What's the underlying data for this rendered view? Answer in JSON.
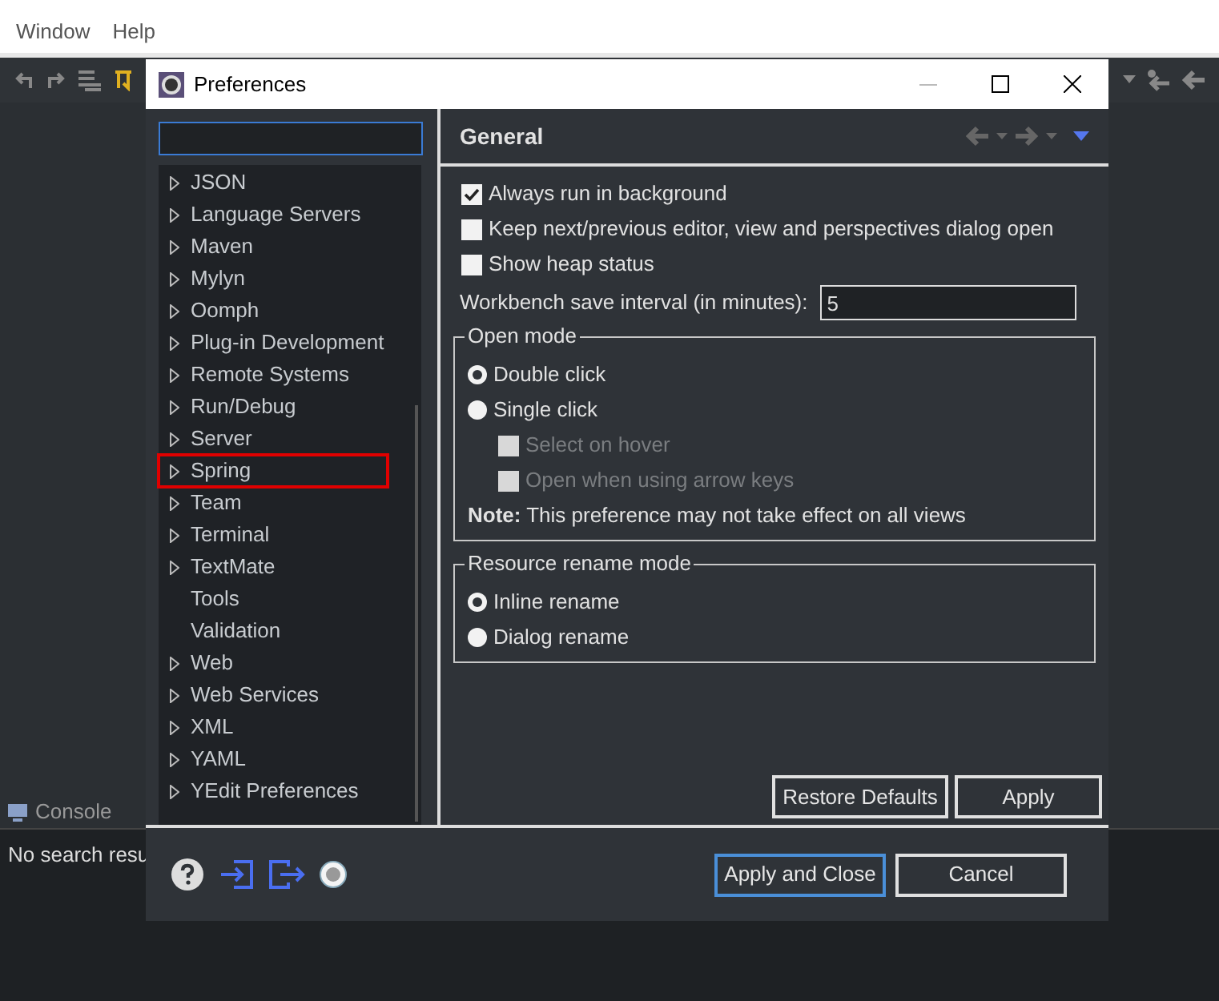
{
  "menu": [
    "Window",
    "Help"
  ],
  "console_tab": {
    "label": "Console"
  },
  "console_text": "No search resu",
  "dialog": {
    "title": "Preferences",
    "tree": [
      {
        "label": "JSON",
        "expandable": true,
        "marked": false
      },
      {
        "label": "Language Servers",
        "expandable": true,
        "marked": false
      },
      {
        "label": "Maven",
        "expandable": true,
        "marked": false
      },
      {
        "label": "Mylyn",
        "expandable": true,
        "marked": false
      },
      {
        "label": "Oomph",
        "expandable": true,
        "marked": false
      },
      {
        "label": "Plug-in Development",
        "expandable": true,
        "marked": false
      },
      {
        "label": "Remote Systems",
        "expandable": true,
        "marked": false
      },
      {
        "label": "Run/Debug",
        "expandable": true,
        "marked": false
      },
      {
        "label": "Server",
        "expandable": true,
        "marked": false
      },
      {
        "label": "Spring",
        "expandable": true,
        "marked": true
      },
      {
        "label": "Team",
        "expandable": true,
        "marked": false
      },
      {
        "label": "Terminal",
        "expandable": true,
        "marked": false
      },
      {
        "label": "TextMate",
        "expandable": true,
        "marked": false
      },
      {
        "label": "Tools",
        "expandable": false,
        "marked": false
      },
      {
        "label": "Validation",
        "expandable": false,
        "marked": false
      },
      {
        "label": "Web",
        "expandable": true,
        "marked": false
      },
      {
        "label": "Web Services",
        "expandable": true,
        "marked": false
      },
      {
        "label": "XML",
        "expandable": true,
        "marked": false
      },
      {
        "label": "YAML",
        "expandable": true,
        "marked": false
      },
      {
        "label": "YEdit Preferences",
        "expandable": true,
        "marked": false
      }
    ],
    "page": {
      "title": "General",
      "options": [
        {
          "label": "Always run in background",
          "checked": true
        },
        {
          "label": "Keep next/previous editor, view and perspectives dialog open",
          "checked": false
        },
        {
          "label": "Show heap status",
          "checked": false
        }
      ],
      "save_interval": {
        "label": "Workbench save interval (in minutes):",
        "value": "5"
      },
      "open_mode": {
        "legend": "Open mode",
        "options": [
          {
            "label": "Double click",
            "selected": true
          },
          {
            "label": "Single click",
            "selected": false
          }
        ],
        "sub_options": [
          {
            "label": "Select on hover",
            "checked": false,
            "disabled": true
          },
          {
            "label": "Open when using arrow keys",
            "checked": false,
            "disabled": true
          }
        ],
        "note": "**Note:** This preference may not take effect on all views"
      },
      "rename_mode": {
        "legend": "Resource rename mode",
        "options": [
          {
            "label": "Inline rename",
            "selected": true
          },
          {
            "label": "Dialog rename",
            "selected": false
          }
        ]
      },
      "buttons": [
        "Restore Defaults",
        "Apply"
      ]
    },
    "footer_buttons": [
      "Apply and Close",
      "Cancel"
    ]
  }
}
